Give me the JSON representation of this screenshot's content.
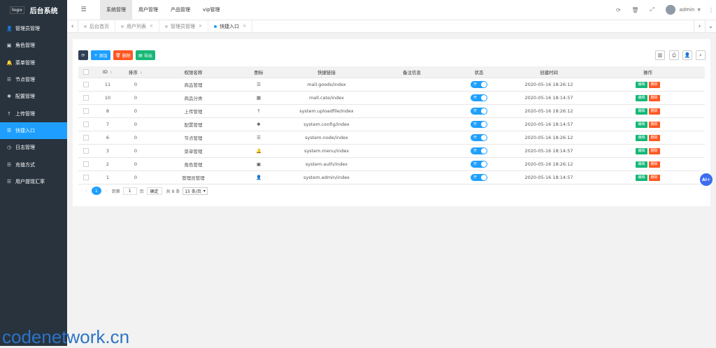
{
  "sidebar": {
    "logo_alt": "logo",
    "title": "后台系统",
    "items": [
      {
        "icon": "user-icon",
        "glyph": "👤",
        "label": "管理员管理"
      },
      {
        "icon": "id-card-icon",
        "glyph": "▣",
        "label": "角色管理"
      },
      {
        "icon": "bell-icon",
        "glyph": "🔔",
        "label": "菜单管理"
      },
      {
        "icon": "list-icon",
        "glyph": "☰",
        "label": "节点管理"
      },
      {
        "icon": "gear-icon",
        "glyph": "✱",
        "label": "配置管理"
      },
      {
        "icon": "upload-icon",
        "glyph": "↑",
        "label": "上传管理"
      },
      {
        "icon": "list-icon",
        "glyph": "☰",
        "label": "快捷入口",
        "active": true
      },
      {
        "icon": "clock-icon",
        "glyph": "◷",
        "label": "日志管理"
      },
      {
        "icon": "list-icon",
        "glyph": "☰",
        "label": "充值方式"
      },
      {
        "icon": "list-icon",
        "glyph": "☰",
        "label": "用户提现汇率"
      }
    ]
  },
  "topnav": {
    "items": [
      "系统管理",
      "用户管理",
      "产品管理",
      "vip管理"
    ],
    "active": 0,
    "username": "admin"
  },
  "tabs": {
    "items": [
      {
        "label": "后台首页",
        "closable": false
      },
      {
        "label": "用户列表",
        "closable": true
      },
      {
        "label": "管理员管理",
        "closable": true
      },
      {
        "label": "快捷入口",
        "closable": true,
        "active": true
      }
    ]
  },
  "toolbar": {
    "add": "添加",
    "delete": "删除",
    "export": "导出"
  },
  "table": {
    "headers": {
      "id": "ID",
      "sort": "排序",
      "name": "权限名称",
      "icon": "图标",
      "link": "快捷链接",
      "remark": "备注信息",
      "status": "状态",
      "created": "创建时间",
      "ops": "操作"
    },
    "rows": [
      {
        "id": "11",
        "sort": "0",
        "name": "商品管理",
        "icon": "list-icon",
        "glyph": "☰",
        "link": "mall.goods/index",
        "remark": "",
        "status": "开",
        "created": "2020-05-16 18:26:12"
      },
      {
        "id": "10",
        "sort": "0",
        "name": "商品分类",
        "icon": "calendar-icon",
        "glyph": "▦",
        "link": "mall.cate/index",
        "remark": "",
        "status": "开",
        "created": "2020-05-16 18:14:57"
      },
      {
        "id": "8",
        "sort": "0",
        "name": "上传管理",
        "icon": "upload-icon",
        "glyph": "↑",
        "link": "system.uploadfile/index",
        "remark": "",
        "status": "开",
        "created": "2020-05-16 18:26:12"
      },
      {
        "id": "7",
        "sort": "0",
        "name": "配置管理",
        "icon": "gear-icon",
        "glyph": "✱",
        "link": "system.config/index",
        "remark": "",
        "status": "开",
        "created": "2020-05-16 18:14:57"
      },
      {
        "id": "6",
        "sort": "0",
        "name": "节点管理",
        "icon": "list-icon",
        "glyph": "☰",
        "link": "system.node/index",
        "remark": "",
        "status": "开",
        "created": "2020-05-16 18:26:12"
      },
      {
        "id": "3",
        "sort": "0",
        "name": "菜单管理",
        "icon": "bell-icon",
        "glyph": "🔔",
        "link": "system.menu/index",
        "remark": "",
        "status": "开",
        "created": "2020-05-16 18:14:57"
      },
      {
        "id": "2",
        "sort": "0",
        "name": "角色管理",
        "icon": "id-card-icon",
        "glyph": "▣",
        "link": "system.auth/index",
        "remark": "",
        "status": "开",
        "created": "2020-05-16 18:26:12"
      },
      {
        "id": "1",
        "sort": "0",
        "name": "管理员管理",
        "icon": "user-icon",
        "glyph": "👤",
        "link": "system.admin/index",
        "remark": "",
        "status": "开",
        "created": "2020-05-16 18:14:57"
      }
    ],
    "edit_label": "编辑",
    "delete_label": "删除"
  },
  "pager": {
    "current": "1",
    "goto_label": "到第",
    "page_input": "1",
    "page_suffix": "页",
    "confirm": "确定",
    "total": "共 8 条",
    "page_size": "15 条/页"
  },
  "ai_badge": "AI+",
  "watermark": "codenetwork.cn"
}
